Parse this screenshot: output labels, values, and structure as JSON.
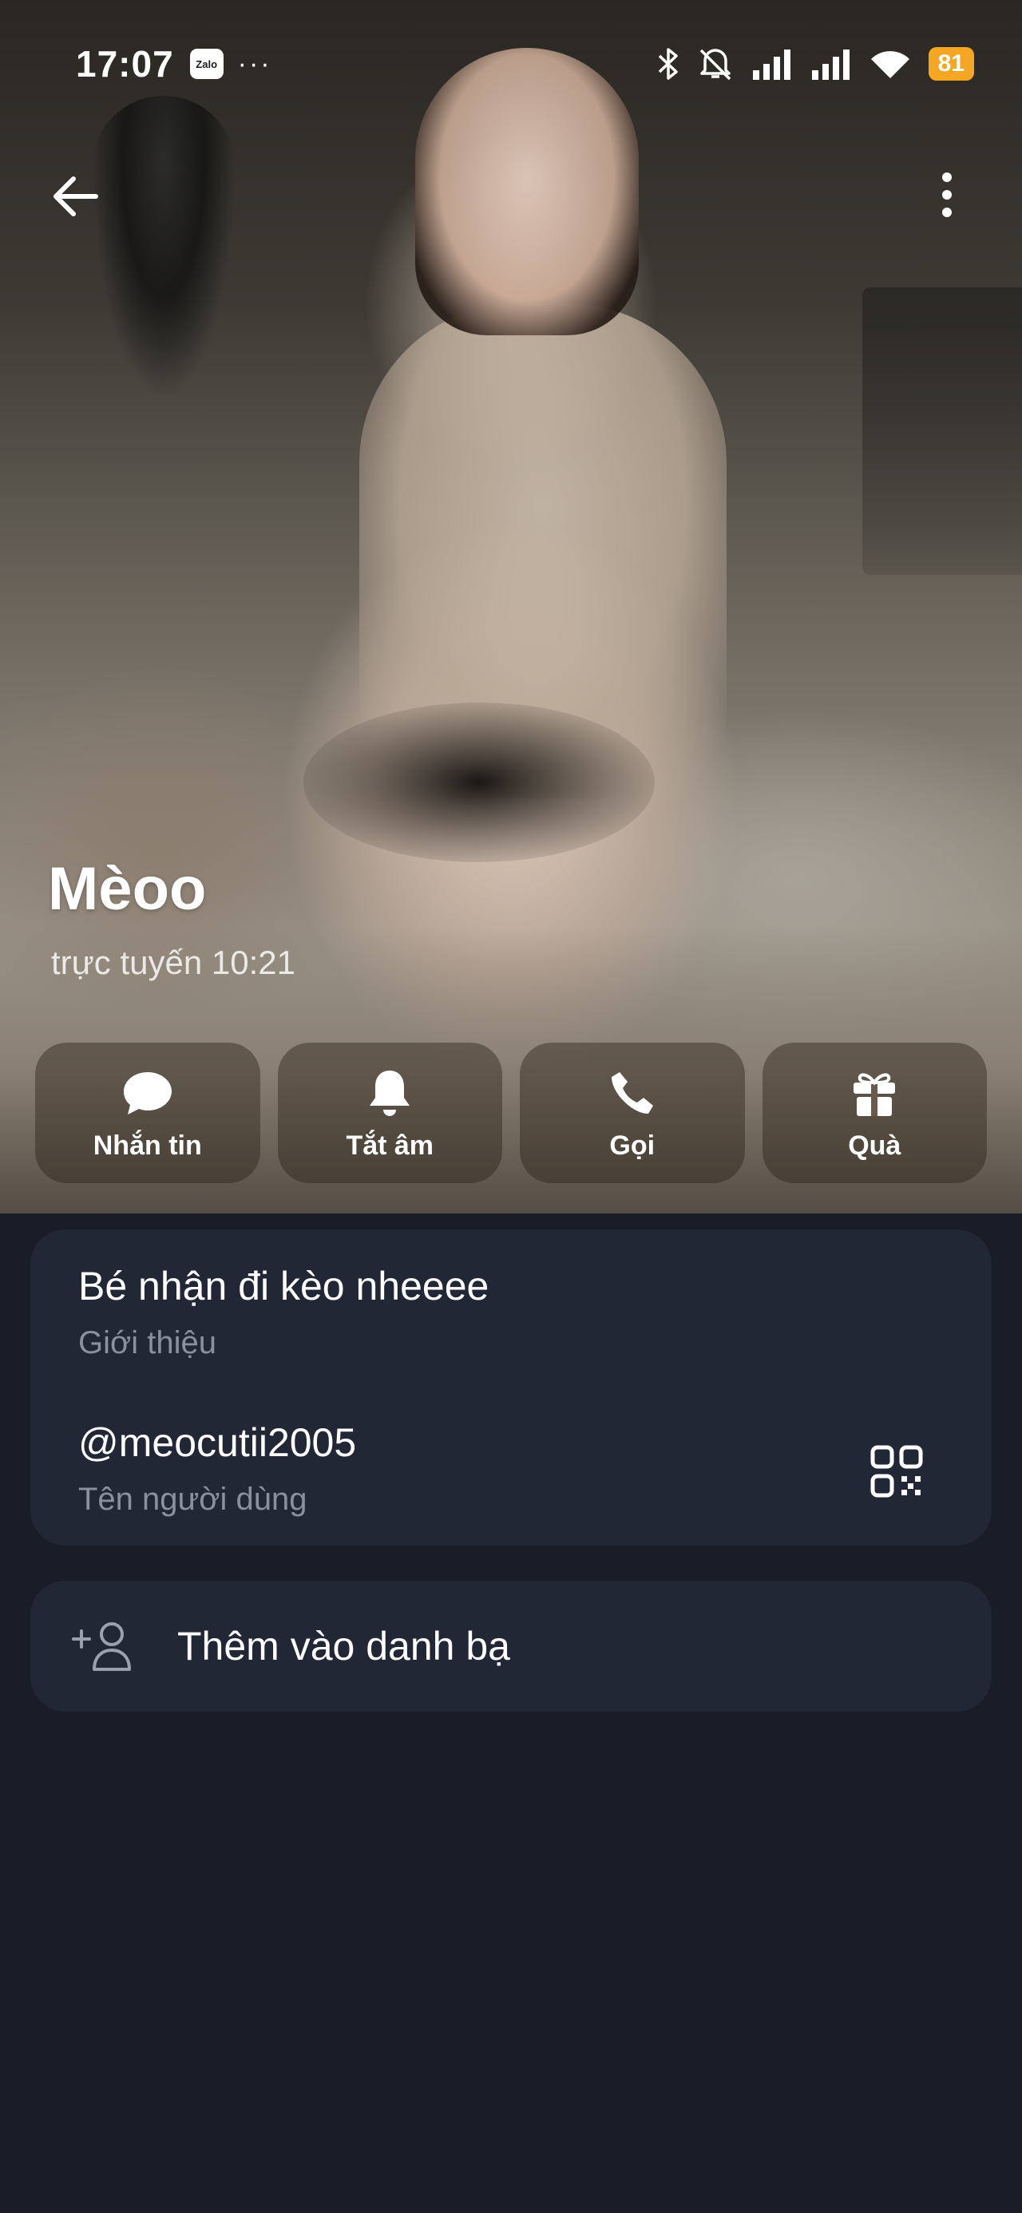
{
  "status_bar": {
    "time": "17:07",
    "app_badge": "Zalo",
    "more_dots": "···",
    "battery": "81",
    "battery_color": "#f5a623",
    "icons": [
      "bluetooth-icon",
      "mute-icon",
      "signal-1-icon",
      "signal-2-icon",
      "wifi-icon"
    ]
  },
  "profile": {
    "name": "Mèoo",
    "status": "trực tuyến 10:21"
  },
  "actions": [
    {
      "label": "Nhắn tin",
      "icon": "chat-bubble-icon"
    },
    {
      "label": "Tắt âm",
      "icon": "bell-icon"
    },
    {
      "label": "Gọi",
      "icon": "phone-icon"
    },
    {
      "label": "Quà",
      "icon": "gift-icon"
    }
  ],
  "info": {
    "bio": "Bé nhận đi kèo nheeee",
    "bio_caption": "Giới thiệu",
    "username": "@meocutii2005",
    "username_caption": "Tên người dùng"
  },
  "add_contact": {
    "label": "Thêm vào danh bạ",
    "icon": "add-person-icon"
  },
  "colors": {
    "background": "#181d27",
    "card": "#212735",
    "caption": "#8a909c"
  }
}
